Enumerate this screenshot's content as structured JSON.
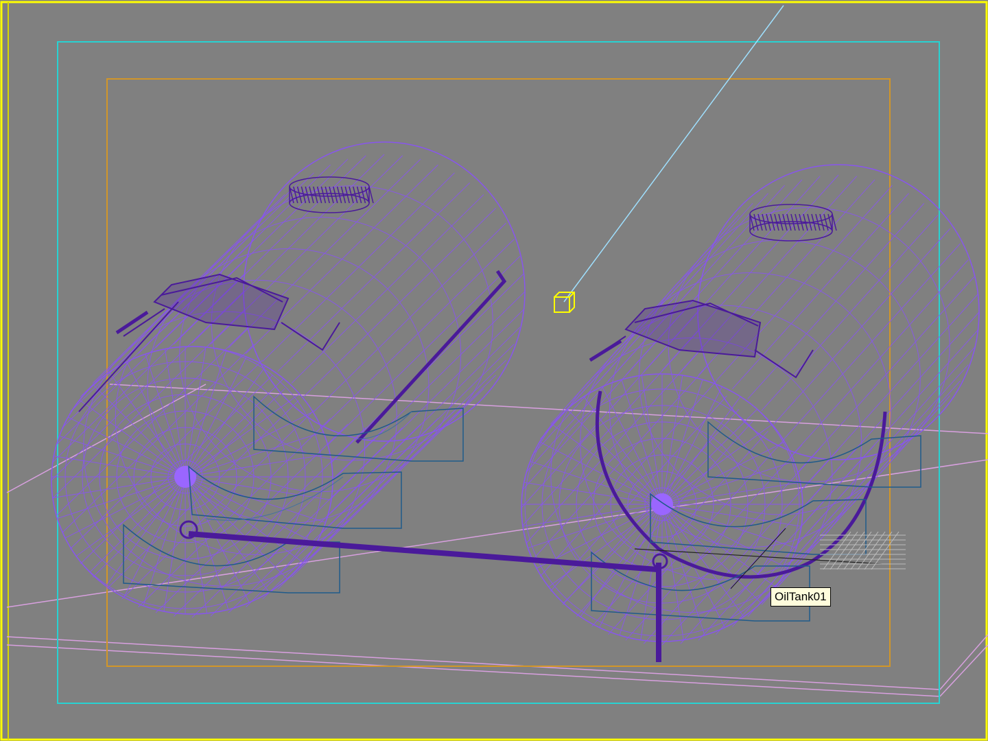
{
  "viewport": {
    "selected_object_tooltip": "OilTank01"
  },
  "colors": {
    "background": "#808080",
    "viewport_border": "#ffff00",
    "safe_frame_outer": "#28d2d2",
    "safe_frame_inner": "#d29628",
    "wireframe": "#8855ee",
    "wireframe_dark": "#4a1a9a",
    "saddle": "#1f5a8a",
    "grid": "#d9a0e0",
    "camera_target": "#ffff00",
    "camera_line": "#9fe0ff"
  },
  "icons": {
    "camera_target": "camera-target-icon"
  }
}
